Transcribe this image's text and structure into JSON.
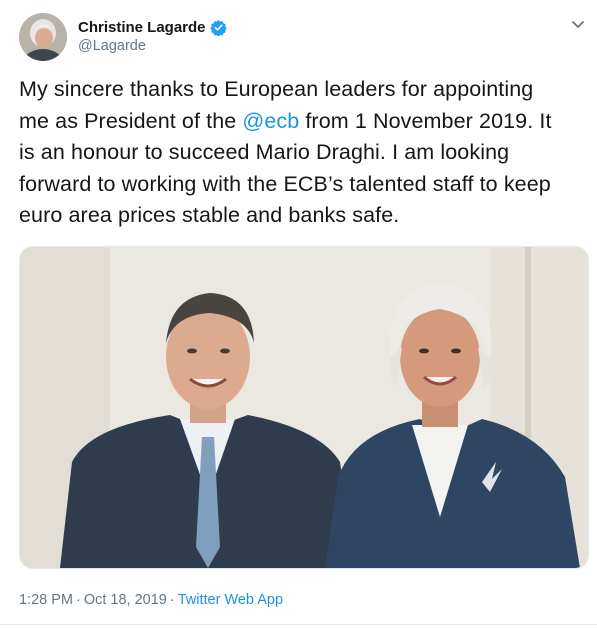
{
  "author": {
    "name": "Christine Lagarde",
    "handle": "@Lagarde",
    "verified": true
  },
  "tweet": {
    "text_line1_pre": "My sincere thanks to European leaders for appointing",
    "text_line2_pre": "me as President of the ",
    "mention": "@ecb",
    "text_line2_post": " from 1 November 2019. It",
    "text_line3": "is an honour to succeed Mario Draghi. I am looking",
    "text_line4": "forward to working with the ECB’s talented staff to keep",
    "text_line5": "euro area prices stable and banks safe."
  },
  "meta": {
    "time": "1:28 PM",
    "separator": "·",
    "date": "Oct 18, 2019",
    "source": "Twitter Web App"
  },
  "icons": {
    "verified": "verified-badge-icon",
    "caret": "chevron-down-icon"
  },
  "colors": {
    "link": "#1b95e0",
    "secondary_text": "#657786",
    "primary_text": "#14171a"
  }
}
